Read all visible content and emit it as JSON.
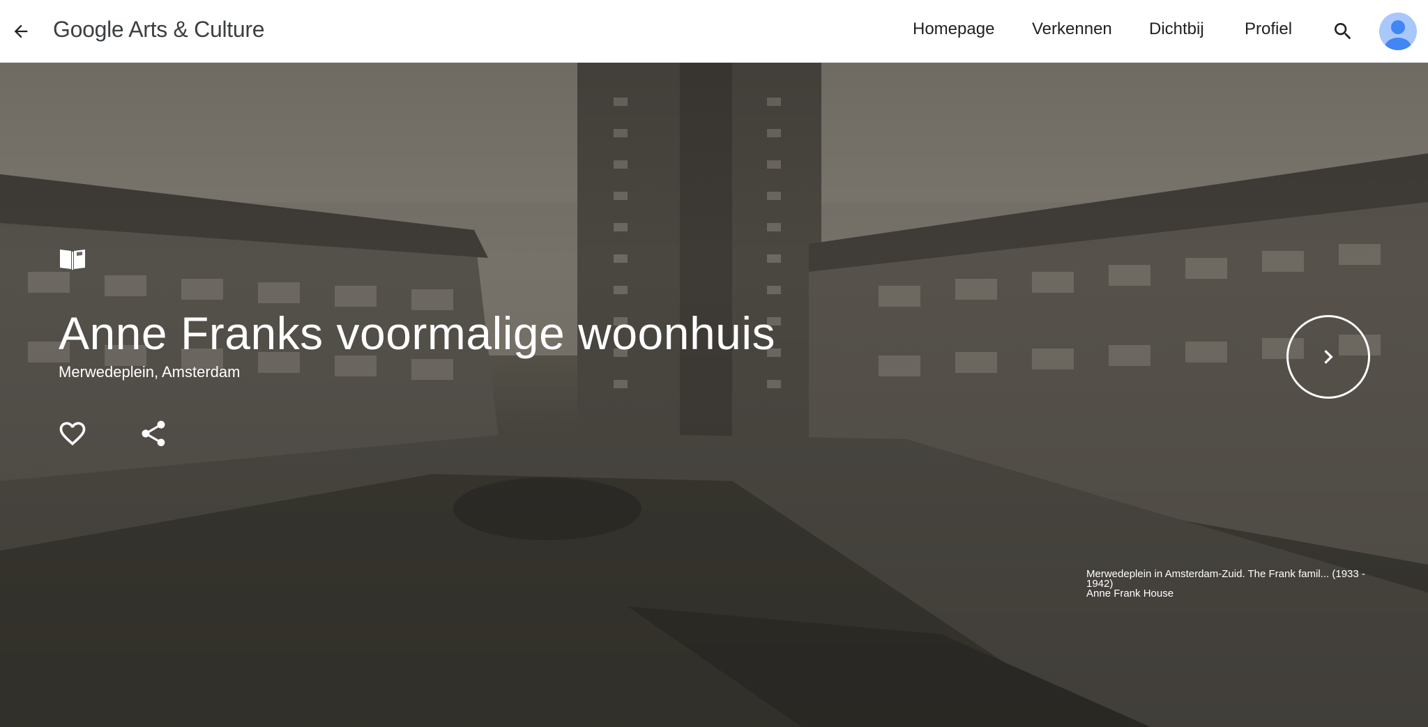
{
  "header": {
    "logo_google": "Google",
    "logo_rest": "Arts & Culture",
    "nav": [
      "Homepage",
      "Verkennen",
      "Dichtbij",
      "Profiel"
    ]
  },
  "hero": {
    "title": "Anne Franks voormalige woonhuis",
    "subtitle": "Merwedeplein, Amsterdam",
    "caption_line1": "Merwedeplein in Amsterdam-Zuid. The Frank famil... (1933 - 1942)",
    "caption_line2": "Anne Frank House"
  },
  "icons": {
    "back": "arrow-left-icon",
    "search": "search-icon",
    "avatar": "person-avatar-icon",
    "story": "open-book-icon",
    "favorite": "heart-icon",
    "share": "share-icon",
    "next": "chevron-right-icon"
  },
  "colors": {
    "avatar_bg": "#a8c7fa",
    "avatar_fg": "#4285f4",
    "text_dark": "#202124"
  }
}
